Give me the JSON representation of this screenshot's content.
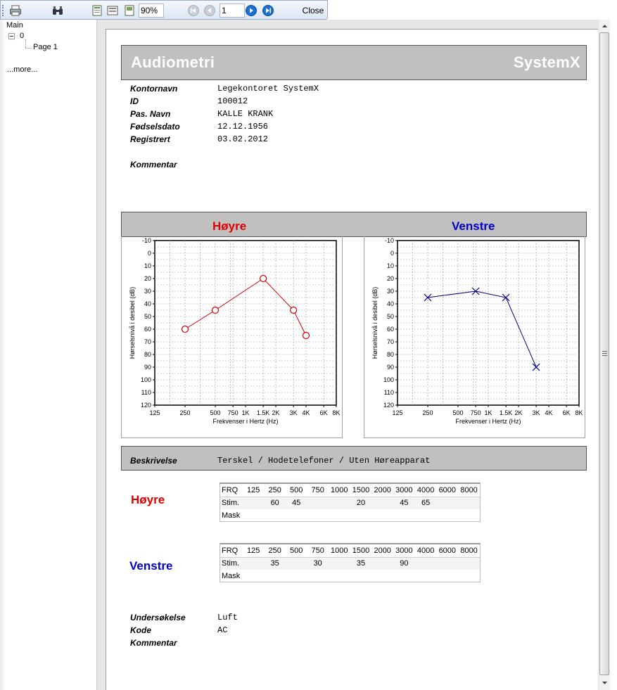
{
  "toolbar": {
    "zoom": "90%",
    "page": "1",
    "close_label": "Close"
  },
  "tree": {
    "root": "Main",
    "node": "0",
    "page": "Page 1",
    "more": "...more..."
  },
  "report": {
    "title": "Audiometri",
    "brand": "SystemX",
    "fields": [
      {
        "label": "Kontornavn",
        "value": "Legekontoret SystemX"
      },
      {
        "label": "ID",
        "value": "100012"
      },
      {
        "label": "Pas. Navn",
        "value": "KALLE KRANK"
      },
      {
        "label": "Fødselsdato",
        "value": "12.12.1956"
      },
      {
        "label": "Registrert",
        "value": "03.02.2012"
      }
    ],
    "kommentar_label": "Kommentar",
    "ear_right": "Høyre",
    "ear_left": "Venstre",
    "beskrivelse_label": "Beskrivelse",
    "beskrivelse_value": "Terskel / Hodetelefoner / Uten Høreapparat",
    "undersokelse_label": "Undersøkelse",
    "undersokelse_value": "Luft",
    "kode_label": "Kode",
    "kode_value": "AC",
    "kommentar2_label": "Kommentar"
  },
  "tables": {
    "header": [
      "FRQ",
      "125",
      "250",
      "500",
      "750",
      "1000",
      "1500",
      "2000",
      "3000",
      "4000",
      "6000",
      "8000"
    ],
    "right": {
      "stim_label": "Stim.",
      "mask_label": "Mask",
      "stim": [
        "",
        "60",
        "45",
        "",
        "",
        "20",
        "",
        "45",
        "65",
        "",
        ""
      ],
      "mask": [
        "",
        "",
        "",
        "",
        "",
        "",
        "",
        "",
        "",
        "",
        ""
      ]
    },
    "left": {
      "stim_label": "Stim.",
      "mask_label": "Mask",
      "stim": [
        "",
        "35",
        "",
        "30",
        "",
        "35",
        "",
        "90",
        "",
        "",
        ""
      ],
      "mask": [
        "",
        "",
        "",
        "",
        "",
        "",
        "",
        "",
        "",
        "",
        ""
      ]
    }
  },
  "chart_data": [
    {
      "type": "line",
      "ear": "Høyre",
      "xlabel": "Frekvenser i Hertz (Hz)",
      "ylabel": "Hørselsnivå i desibel (dB)",
      "x_ticks": [
        "125",
        "250",
        "500",
        "750",
        "1K",
        "1.5K",
        "2K",
        "3K",
        "4K",
        "6K",
        "8K"
      ],
      "y_ticks": [
        "-10",
        "0",
        "10",
        "20",
        "30",
        "40",
        "50",
        "60",
        "70",
        "80",
        "90",
        "100",
        "110",
        "120"
      ],
      "ylim": [
        -10,
        120
      ],
      "y_inverted": true,
      "x_scale": "log",
      "marker": "circle",
      "color": "#cc0000",
      "grid": true,
      "series": [
        {
          "x": [
            250,
            500,
            1500,
            3000,
            4000
          ],
          "y": [
            60,
            45,
            20,
            45,
            65
          ]
        }
      ]
    },
    {
      "type": "line",
      "ear": "Venstre",
      "xlabel": "Frekvenser i Hertz (Hz)",
      "ylabel": "Hørselsnivå i desibel (dB)",
      "x_ticks": [
        "125",
        "250",
        "500",
        "750",
        "1K",
        "1.5K",
        "2K",
        "3K",
        "4K",
        "6K",
        "8K"
      ],
      "y_ticks": [
        "-10",
        "0",
        "10",
        "20",
        "30",
        "40",
        "50",
        "60",
        "70",
        "80",
        "90",
        "100",
        "110",
        "120"
      ],
      "ylim": [
        -10,
        120
      ],
      "y_inverted": true,
      "x_scale": "log",
      "marker": "x",
      "color": "#00007a",
      "grid": true,
      "series": [
        {
          "x": [
            250,
            750,
            1500,
            3000
          ],
          "y": [
            35,
            30,
            35,
            90
          ]
        }
      ]
    }
  ]
}
